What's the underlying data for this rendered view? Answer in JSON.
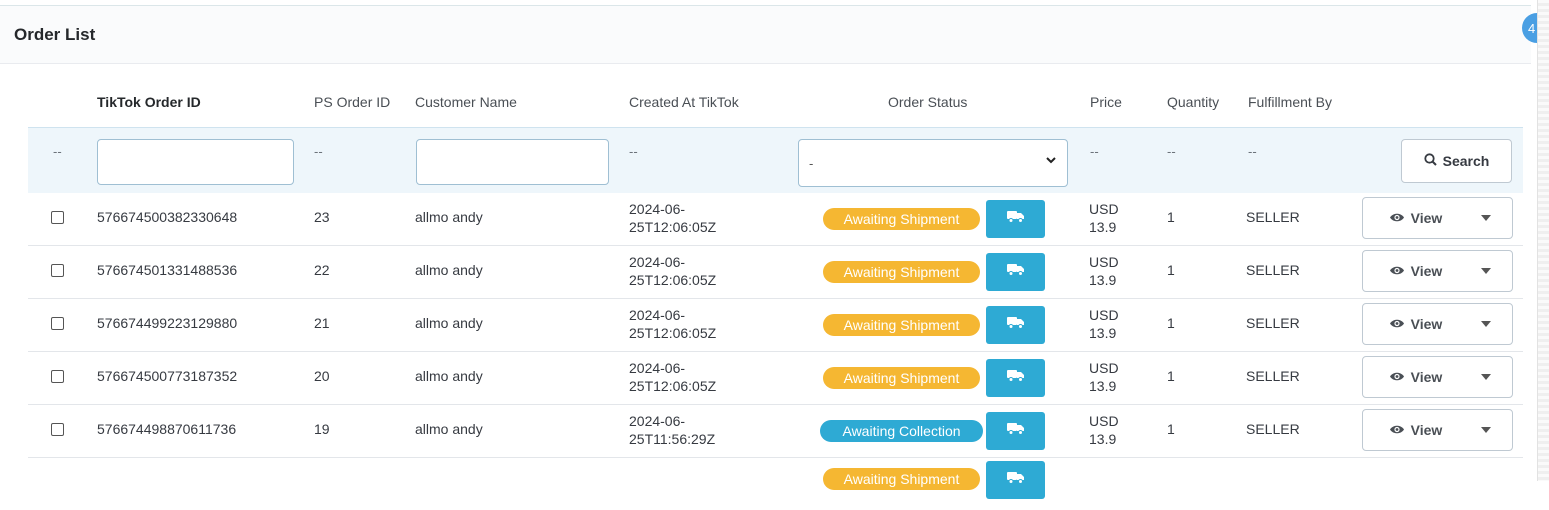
{
  "panel": {
    "title": "Order List",
    "badge": "4"
  },
  "columns": [
    {
      "label": "TikTok Order ID",
      "bold": true
    },
    {
      "label": "PS Order ID"
    },
    {
      "label": "Customer Name"
    },
    {
      "label": "Created At TikTok"
    },
    {
      "label": "Order Status"
    },
    {
      "label": "Price"
    },
    {
      "label": "Quantity"
    },
    {
      "label": "Fulfillment By"
    }
  ],
  "filters": {
    "dash": "--",
    "tiktok_order_id": "",
    "customer_name": "",
    "order_status_selected": "-",
    "search_label": "Search"
  },
  "colors": {
    "awaiting_shipment": "#f5b732",
    "awaiting_collection": "#2eaad4",
    "truck_button": "#2eaad4"
  },
  "rows": [
    {
      "tiktok_id": "576674500382330648",
      "ps_id": "23",
      "customer": "allmo andy",
      "created_l1": "2024-06-",
      "created_l2": "25T12:06:05Z",
      "status": "Awaiting Shipment",
      "status_type": "shipment",
      "price_l1": "USD",
      "price_l2": "13.9",
      "quantity": "1",
      "fulfillment": "SELLER",
      "view_label": "View"
    },
    {
      "tiktok_id": "576674501331488536",
      "ps_id": "22",
      "customer": "allmo andy",
      "created_l1": "2024-06-",
      "created_l2": "25T12:06:05Z",
      "status": "Awaiting Shipment",
      "status_type": "shipment",
      "price_l1": "USD",
      "price_l2": "13.9",
      "quantity": "1",
      "fulfillment": "SELLER",
      "view_label": "View"
    },
    {
      "tiktok_id": "576674499223129880",
      "ps_id": "21",
      "customer": "allmo andy",
      "created_l1": "2024-06-",
      "created_l2": "25T12:06:05Z",
      "status": "Awaiting Shipment",
      "status_type": "shipment",
      "price_l1": "USD",
      "price_l2": "13.9",
      "quantity": "1",
      "fulfillment": "SELLER",
      "view_label": "View"
    },
    {
      "tiktok_id": "576674500773187352",
      "ps_id": "20",
      "customer": "allmo andy",
      "created_l1": "2024-06-",
      "created_l2": "25T12:06:05Z",
      "status": "Awaiting Shipment",
      "status_type": "shipment",
      "price_l1": "USD",
      "price_l2": "13.9",
      "quantity": "1",
      "fulfillment": "SELLER",
      "view_label": "View"
    },
    {
      "tiktok_id": "576674498870611736",
      "ps_id": "19",
      "customer": "allmo andy",
      "created_l1": "2024-06-",
      "created_l2": "25T11:56:29Z",
      "status": "Awaiting Collection",
      "status_type": "collection",
      "price_l1": "USD",
      "price_l2": "13.9",
      "quantity": "1",
      "fulfillment": "SELLER",
      "view_label": "View"
    }
  ],
  "partial_row": {
    "status": "Awaiting Shipment"
  },
  "icons": {
    "search": "search-icon",
    "truck": "truck-icon",
    "eye": "eye-icon",
    "caret": "caret-down-icon",
    "chevron": "chevron-down-icon"
  }
}
